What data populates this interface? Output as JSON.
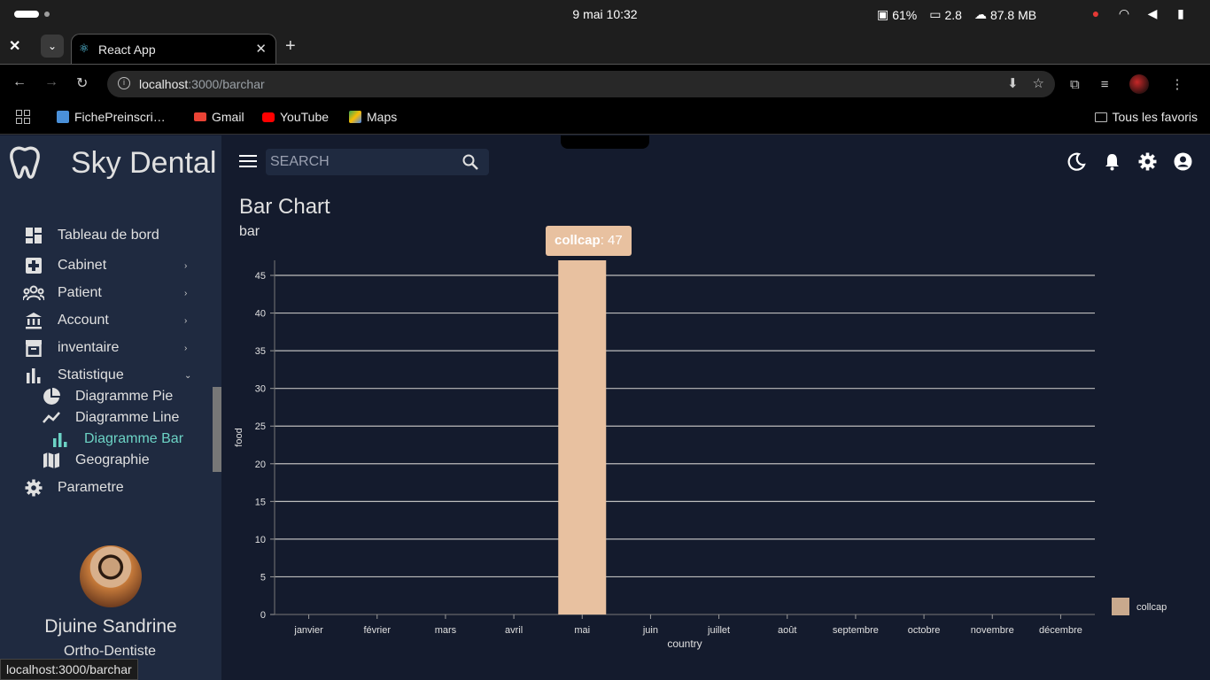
{
  "os": {
    "date_time": "9 mai  10:32",
    "battery": "61%",
    "load": "2.8",
    "memory": "87.8 MB"
  },
  "browser": {
    "tab_title": "React App",
    "url_host": "localhost",
    "url_rest": ":3000/barchar",
    "bookmarks": [
      {
        "label": "FichePreinscri…",
        "icon": "cube-icon",
        "color": "#4a90d9"
      },
      {
        "label": "Gmail",
        "icon": "gmail-icon",
        "color": "#ea4335"
      },
      {
        "label": "YouTube",
        "icon": "youtube-icon",
        "color": "#ff0000"
      },
      {
        "label": "Maps",
        "icon": "maps-icon",
        "color": "#34a853"
      }
    ],
    "all_bookmarks": "Tous les favoris",
    "status_url": "localhost:3000/barchar"
  },
  "sidebar": {
    "app_name": "Sky Dental",
    "items": [
      {
        "label": "Tableau de bord",
        "icon": "dashboard-icon"
      },
      {
        "label": "Cabinet",
        "icon": "hospital-icon",
        "chevron": "›"
      },
      {
        "label": "Patient",
        "icon": "group-icon",
        "chevron": "›"
      },
      {
        "label": "Account",
        "icon": "bank-icon",
        "chevron": "›"
      },
      {
        "label": "inventaire",
        "icon": "archive-icon",
        "chevron": "›"
      },
      {
        "label": "Statistique",
        "icon": "bar-chart-icon",
        "chevron": "⌄"
      }
    ],
    "sub_items": [
      {
        "label": "Diagramme Pie",
        "icon": "pie-chart-icon"
      },
      {
        "label": "Diagramme Line",
        "icon": "line-chart-icon"
      },
      {
        "label": "Diagramme Bar",
        "icon": "bar-chart-icon"
      },
      {
        "label": "Geographie",
        "icon": "map-icon"
      }
    ],
    "settings_label": "Parametre",
    "user_name": "Djuine Sandrine",
    "user_role": "Ortho-Dentiste"
  },
  "topbar": {
    "search_placeholder": "SEARCH"
  },
  "page": {
    "title": "Bar Chart",
    "subtitle": "bar"
  },
  "tooltip": {
    "series": "collcap",
    "value": "47"
  },
  "colors": {
    "bar": "#e8c1a0",
    "legend_swatch": "#c9a98d",
    "accent": "#6cd3c5"
  },
  "chart_data": {
    "type": "bar",
    "categories": [
      "janvier",
      "février",
      "mars",
      "avril",
      "mai",
      "juin",
      "juillet",
      "août",
      "septembre",
      "octobre",
      "novembre",
      "décembre"
    ],
    "series": [
      {
        "name": "collcap",
        "values": [
          0,
          0,
          0,
          0,
          47,
          0,
          0,
          0,
          0,
          0,
          0,
          0
        ]
      }
    ],
    "xlabel": "country",
    "ylabel": "food",
    "ylim": [
      0,
      47
    ],
    "yticks": [
      0,
      5,
      10,
      15,
      20,
      25,
      30,
      35,
      40,
      45
    ],
    "grid": true,
    "legend": "right"
  }
}
